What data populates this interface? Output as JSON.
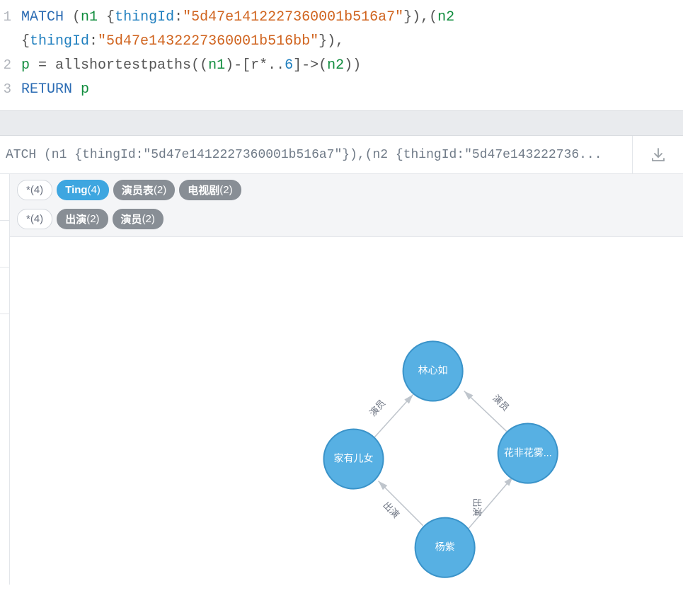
{
  "code": {
    "line1": {
      "kw": "MATCH",
      "seg1": " (",
      "var1": "n1",
      "seg2": " {",
      "prop1": "thingId",
      "seg3": ":",
      "str1": "\"5d47e1412227360001b516a7\"",
      "seg4": "}),(",
      "var2": "n2"
    },
    "line1b": {
      "seg1": "{",
      "prop1": "thingId",
      "seg2": ":",
      "str1": "\"5d47e1432227360001b516bb\"",
      "seg3": "}),"
    },
    "line2": {
      "var1": "p",
      "seg1": " = ",
      "func": "allshortestpaths",
      "seg2": "((",
      "v1": "n1",
      "seg3": ")-[",
      "rel": "r",
      "seg4": "*..",
      "num": "6",
      "seg5": "]->(",
      "v2": "n2",
      "seg6": "))"
    },
    "line3": {
      "kw": "RETURN",
      "seg1": " ",
      "var": "p"
    }
  },
  "queryBar": {
    "text": "ATCH (n1 {thingId:\"5d47e1412227360001b516a7\"}),(n2 {thingId:\"5d47e143222736..."
  },
  "nodePills": [
    {
      "label": "*",
      "count": "(4)",
      "style": "clear"
    },
    {
      "label": "Ting",
      "count": "(4)",
      "style": "blue"
    },
    {
      "label": "演员表",
      "count": "(2)",
      "style": "grey"
    },
    {
      "label": "电视剧",
      "count": "(2)",
      "style": "grey"
    }
  ],
  "relPills": [
    {
      "label": "*",
      "count": "(4)",
      "style": "clear"
    },
    {
      "label": "出演",
      "count": "(2)",
      "style": "grey"
    },
    {
      "label": "演员",
      "count": "(2)",
      "style": "grey"
    }
  ],
  "graph": {
    "nodes": {
      "top": {
        "label": "林心如"
      },
      "left": {
        "label": "家有儿女"
      },
      "right": {
        "label": "花非花雾..."
      },
      "bottom": {
        "label": "杨紫"
      }
    },
    "edges": {
      "leftTop": {
        "label": "演员"
      },
      "rightTop": {
        "label": "演员"
      },
      "bottomLeft": {
        "label": "出演"
      },
      "bottomRight": {
        "label": "出演"
      }
    }
  }
}
